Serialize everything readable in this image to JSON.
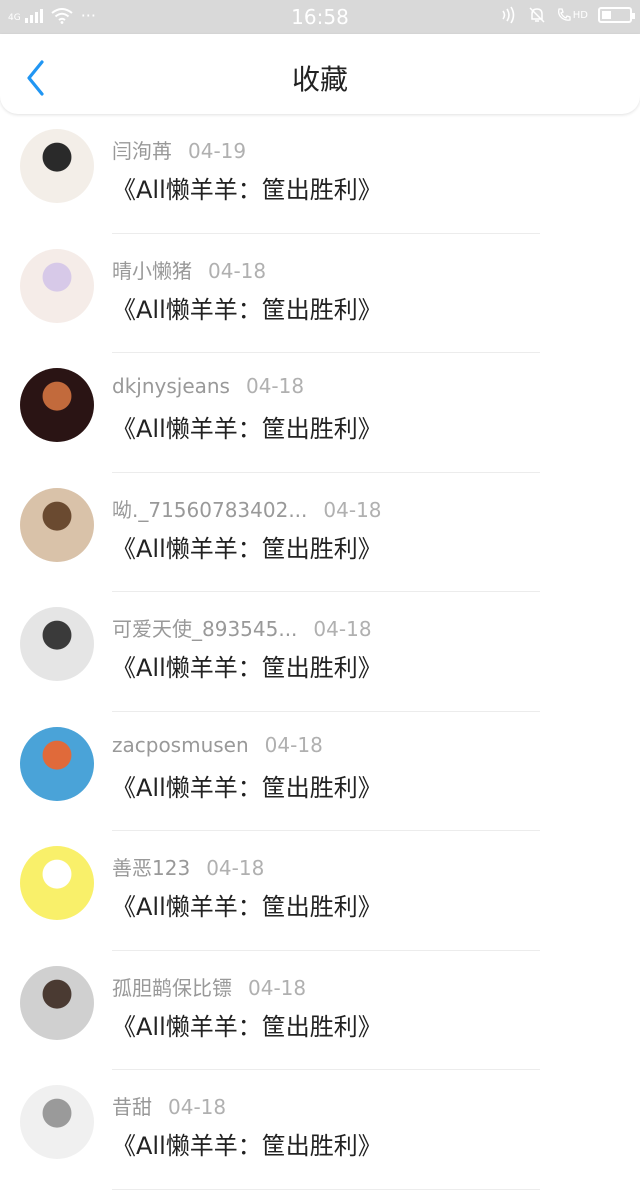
{
  "status_bar": {
    "time": "16:58",
    "signal_text": "4G",
    "dots": "···",
    "hd_label": "HD"
  },
  "header": {
    "title": "收藏",
    "back_icon": "chevron-left-icon",
    "accent_color": "#2196f3"
  },
  "items": [
    {
      "name": "闫洵苒",
      "date": "04-19",
      "title": "《All懒羊羊：筐出胜利》",
      "avatar_colors": [
        "#f3eee8",
        "#2a2a2a"
      ]
    },
    {
      "name": "晴小懒猪",
      "date": "04-18",
      "title": "《All懒羊羊：筐出胜利》",
      "avatar_colors": [
        "#f5ece8",
        "#d7c9e8"
      ]
    },
    {
      "name": "dkjnysjeans",
      "date": "04-18",
      "title": "《All懒羊羊：筐出胜利》",
      "avatar_colors": [
        "#2a1414",
        "#c26a3c"
      ]
    },
    {
      "name": "呦._71560783402...",
      "date": "04-18",
      "title": "《All懒羊羊：筐出胜利》",
      "avatar_colors": [
        "#d9c2a9",
        "#6a4a30"
      ]
    },
    {
      "name": "可爱天使_893545...",
      "date": "04-18",
      "title": "《All懒羊羊：筐出胜利》",
      "avatar_colors": [
        "#e5e5e5",
        "#3a3a3a"
      ]
    },
    {
      "name": "zacposmusen",
      "date": "04-18",
      "title": "《All懒羊羊：筐出胜利》",
      "avatar_colors": [
        "#4aa3d8",
        "#e06a3a"
      ]
    },
    {
      "name": "善恶123",
      "date": "04-18",
      "title": "《All懒羊羊：筐出胜利》",
      "avatar_colors": [
        "#f9f06a",
        "#ffffff"
      ]
    },
    {
      "name": "孤胆鹋保比镖",
      "date": "04-18",
      "title": "《All懒羊羊：筐出胜利》",
      "avatar_colors": [
        "#d0d0d0",
        "#4a3a32"
      ]
    },
    {
      "name": "昔甜",
      "date": "04-18",
      "title": "《All懒羊羊：筐出胜利》",
      "avatar_colors": [
        "#f0f0f0",
        "#9a9a9a"
      ]
    }
  ]
}
